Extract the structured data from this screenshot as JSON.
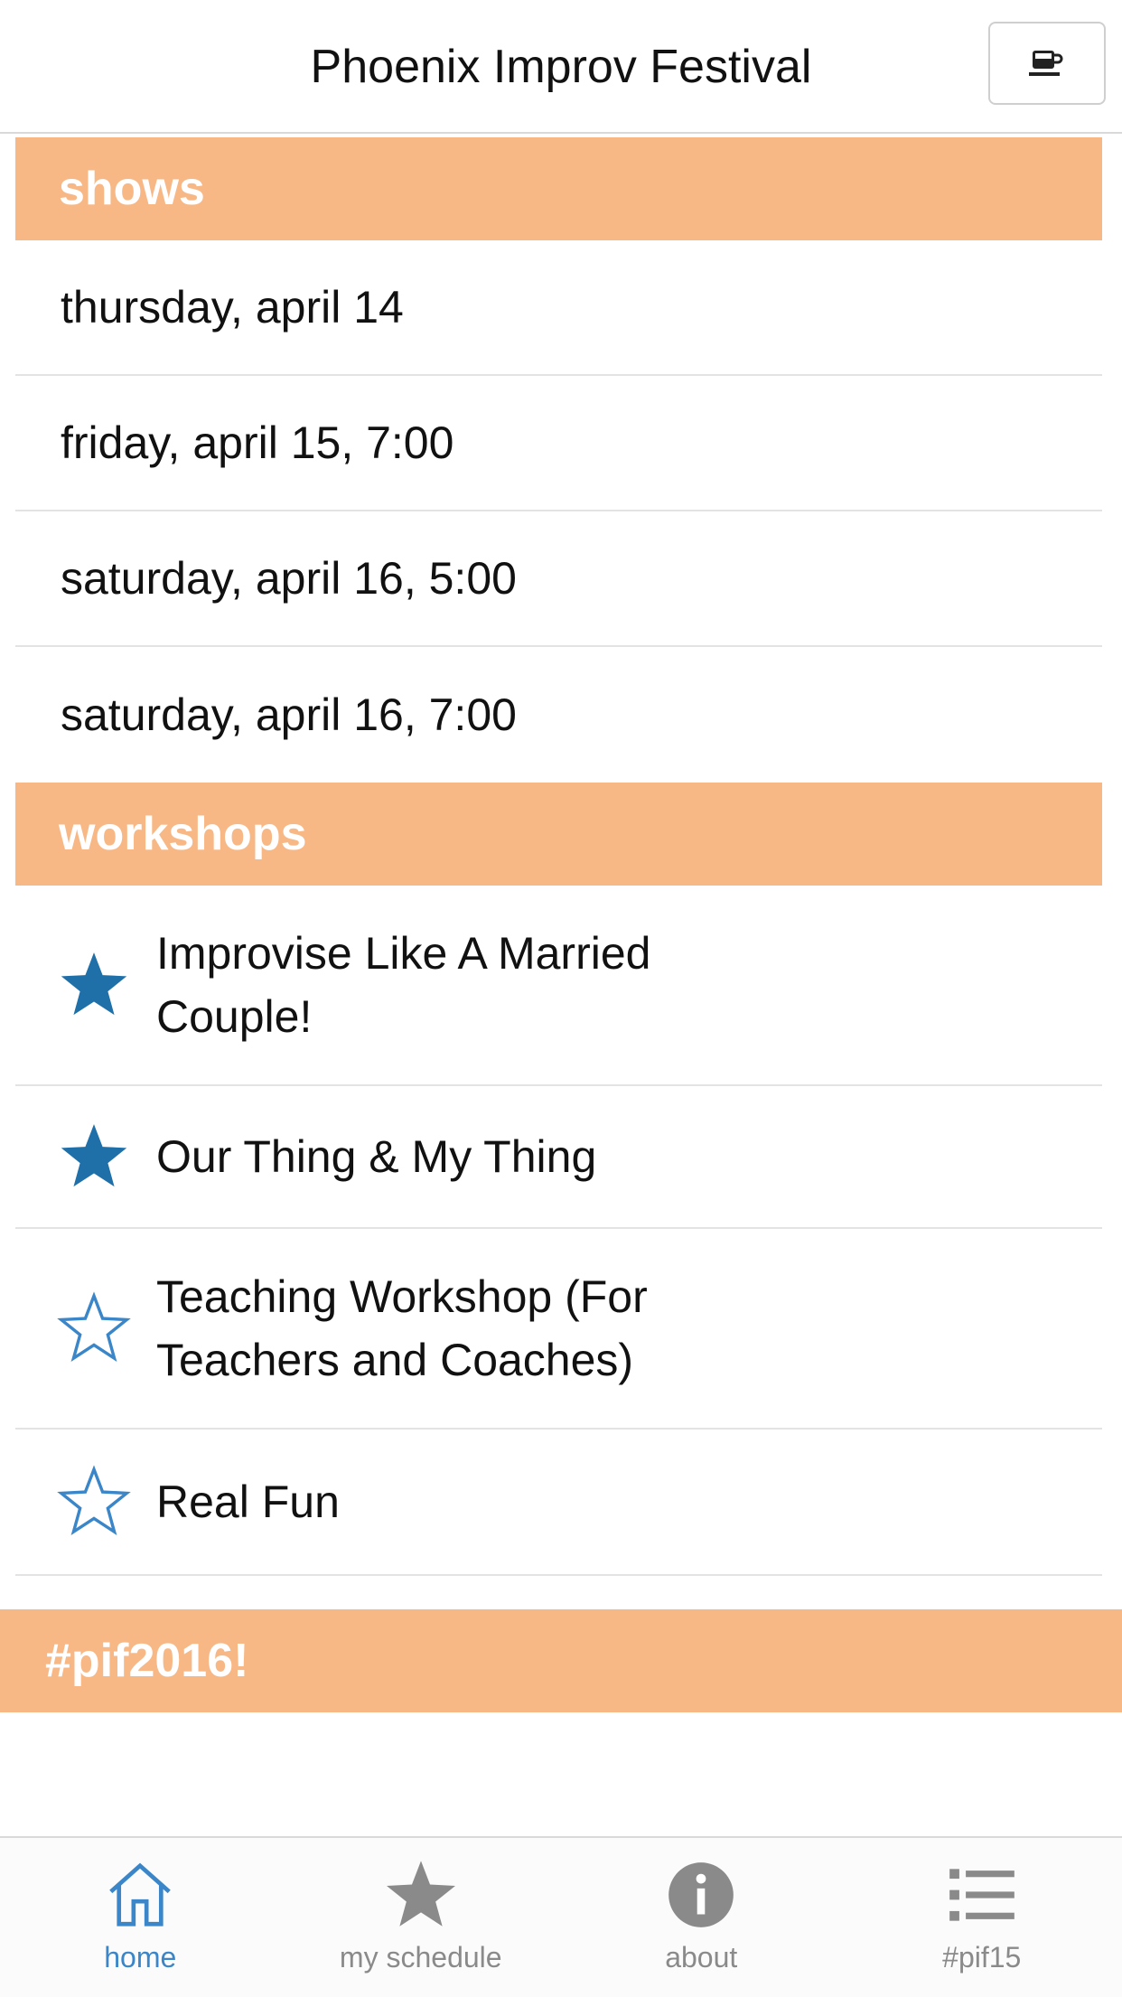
{
  "header": {
    "title": "Phoenix Improv Festival",
    "menu_icon": "coffee-cup-icon"
  },
  "shows": {
    "heading": "shows",
    "items": [
      {
        "label": "thursday, april 14"
      },
      {
        "label": "friday, april 15, 7:00"
      },
      {
        "label": "saturday, april 16, 5:00"
      },
      {
        "label": "saturday, april 16, 7:00"
      }
    ]
  },
  "workshops": {
    "heading": "workshops",
    "items": [
      {
        "label": "Improvise Like A Married Couple!",
        "starred": true
      },
      {
        "label": "Our Thing & My Thing",
        "starred": true
      },
      {
        "label": "Teaching Workshop (For Teachers and Coaches)",
        "starred": false
      },
      {
        "label": "Real Fun",
        "starred": false
      }
    ]
  },
  "hashtag_banner": "#pif2016!",
  "tabbar": {
    "tabs": [
      {
        "label": "home",
        "icon": "home-icon",
        "active": true
      },
      {
        "label": "my schedule",
        "icon": "star-icon",
        "active": false
      },
      {
        "label": "about",
        "icon": "info-icon",
        "active": false
      },
      {
        "label": "#pif15",
        "icon": "list-icon",
        "active": false
      }
    ]
  },
  "colors": {
    "section_bg": "#f7b885",
    "star_blue": "#1f6fa8",
    "tab_active": "#3a86c8",
    "tab_inactive": "#8a8a8a"
  }
}
